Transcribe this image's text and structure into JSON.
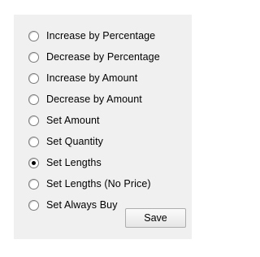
{
  "options": [
    {
      "label": "Increase by Percentage",
      "selected": false
    },
    {
      "label": "Decrease by Percentage",
      "selected": false
    },
    {
      "label": "Increase by Amount",
      "selected": false
    },
    {
      "label": "Decrease by Amount",
      "selected": false
    },
    {
      "label": "Set Amount",
      "selected": false
    },
    {
      "label": "Set Quantity",
      "selected": false
    },
    {
      "label": "Set Lengths",
      "selected": true
    },
    {
      "label": "Set Lengths (No Price)",
      "selected": false
    },
    {
      "label": "Set Always Buy",
      "selected": false
    }
  ],
  "buttons": {
    "save_label": "Save"
  }
}
